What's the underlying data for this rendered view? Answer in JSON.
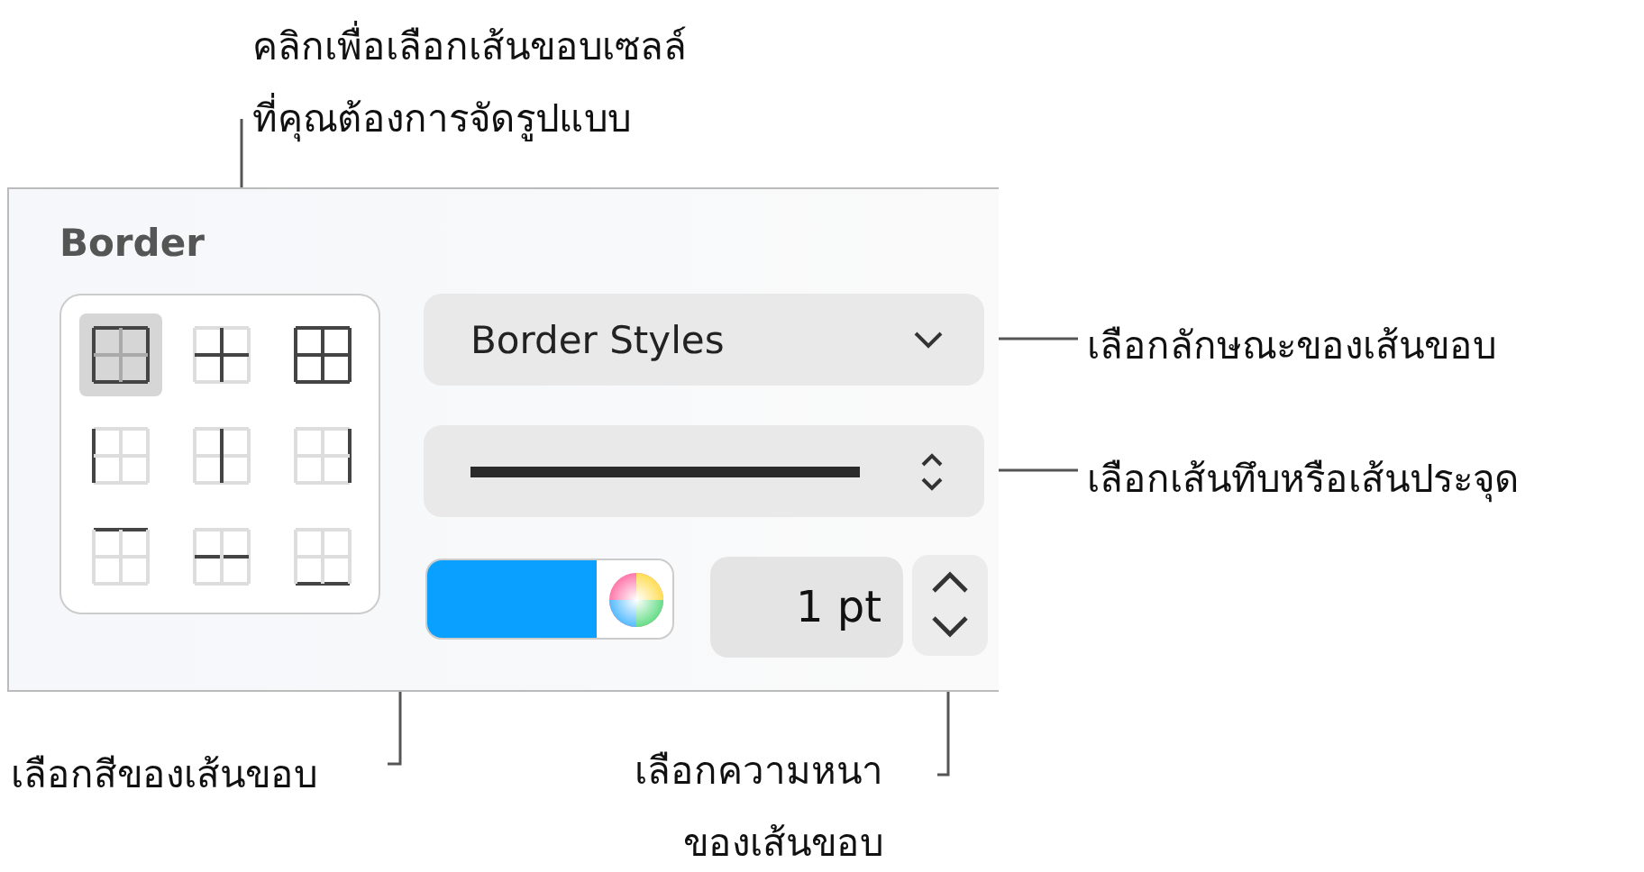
{
  "callouts": [
    {
      "kind": "top",
      "lines": [
        "คลิกเพื่อเลือกเส้นขอบเซลล์",
        "ที่คุณต้องการจัดรูปแบบ"
      ]
    },
    {
      "kind": "style",
      "lines": [
        "เลือกลักษณะของเส้นขอบ"
      ]
    },
    {
      "kind": "line",
      "lines": [
        "เลือกเส้นทึบหรือเส้นประจุด"
      ]
    },
    {
      "kind": "color",
      "lines": [
        "เลือกสีของเส้นขอบ"
      ]
    },
    {
      "kind": "width",
      "lines": [
        "เลือกความหนา",
        "ของเส้นขอบ"
      ]
    }
  ],
  "panel": {
    "title": "Border",
    "border_buttons": [
      {
        "kind": "outer",
        "selected": true
      },
      {
        "kind": "inner",
        "selected": false
      },
      {
        "kind": "all",
        "selected": false
      },
      {
        "kind": "left",
        "selected": false
      },
      {
        "kind": "vertical",
        "selected": false
      },
      {
        "kind": "right",
        "selected": false
      },
      {
        "kind": "top",
        "selected": false
      },
      {
        "kind": "horizontal",
        "selected": false
      },
      {
        "kind": "bottom",
        "selected": false
      }
    ],
    "style_menu": "Border Styles",
    "color_well": {
      "color": "#0aa0ff"
    },
    "width_value": "1 pt"
  }
}
